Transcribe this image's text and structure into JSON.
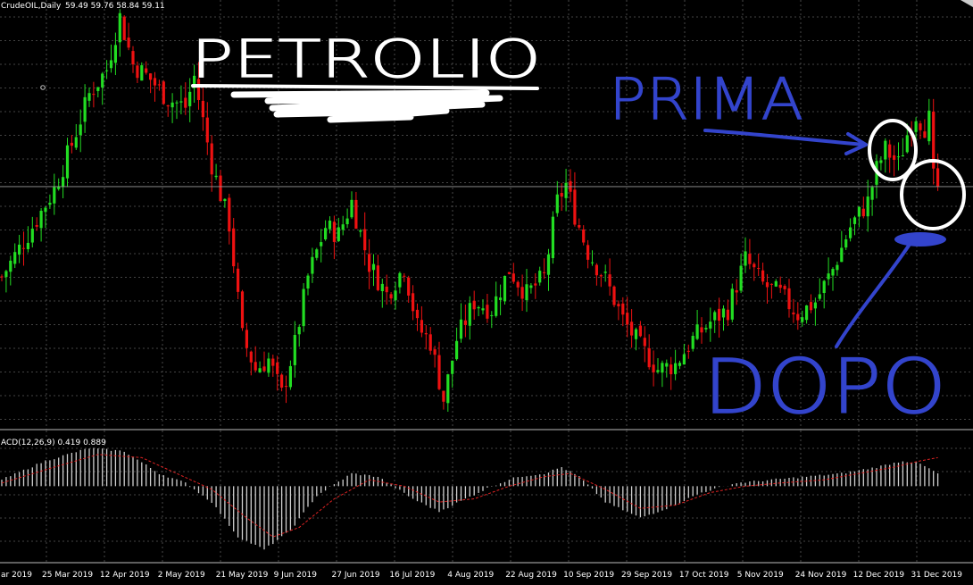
{
  "window": {
    "symbol_label": "CrudeOIL,Daily",
    "ohlc_label": "59.49 59.76 58.84 59.11",
    "macd_label": "ACD(12,26,9) 0.419 0.889"
  },
  "annotations": {
    "title": "PETROLIO",
    "before": "PRIMA",
    "after": "DOPO"
  },
  "colors": {
    "background": "#000000",
    "grid": "#5a5a5a",
    "bull": "#22dd22",
    "bear": "#ee1111",
    "macd_hist": "#d0d0d0",
    "macd_signal": "#dd2222",
    "ink_white": "#ffffff",
    "ink_blue": "#3344cc"
  },
  "chart_data": [
    {
      "type": "candlestick",
      "symbol": "CrudeOIL",
      "timeframe": "Daily",
      "x_tick_labels": [
        "ar 2019",
        "25 Mar 2019",
        "12 Apr 2019",
        "2 May 2019",
        "21 May 2019",
        "9 Jun 2019",
        "27 Jun 2019",
        "16 Jul 2019",
        "4 Aug 2019",
        "22 Aug 2019",
        "10 Sep 2019",
        "29 Sep 2019",
        "17 Oct 2019",
        "5 Nov 2019",
        "24 Nov 2019",
        "12 Dec 2019",
        "31 Dec 2019"
      ],
      "ylim": [
        49.5,
        66.5
      ],
      "close_path": [
        [
          0,
          55.5
        ],
        [
          6,
          57.2
        ],
        [
          12,
          59.0
        ],
        [
          16,
          60.8
        ],
        [
          20,
          62.8
        ],
        [
          24,
          63.8
        ],
        [
          27,
          65.9
        ],
        [
          30,
          64.0
        ],
        [
          34,
          63.4
        ],
        [
          38,
          62.6
        ],
        [
          42,
          62.3
        ],
        [
          44,
          63.5
        ],
        [
          48,
          60.0
        ],
        [
          52,
          57.6
        ],
        [
          55,
          53.1
        ],
        [
          58,
          51.8
        ],
        [
          61,
          52.2
        ],
        [
          64,
          50.8
        ],
        [
          67,
          52.8
        ],
        [
          70,
          55.5
        ],
        [
          74,
          57.5
        ],
        [
          77,
          57.2
        ],
        [
          80,
          58.5
        ],
        [
          84,
          56.0
        ],
        [
          88,
          54.8
        ],
        [
          92,
          55.9
        ],
        [
          95,
          53.5
        ],
        [
          98,
          52.9
        ],
        [
          101,
          50.6
        ],
        [
          104,
          53.0
        ],
        [
          108,
          54.5
        ],
        [
          112,
          54.2
        ],
        [
          116,
          55.8
        ],
        [
          120,
          54.8
        ],
        [
          124,
          55.5
        ],
        [
          127,
          58.5
        ],
        [
          129,
          59.2
        ],
        [
          131,
          58.0
        ],
        [
          134,
          56.5
        ],
        [
          138,
          55.4
        ],
        [
          142,
          53.8
        ],
        [
          146,
          52.7
        ],
        [
          150,
          51.8
        ],
        [
          154,
          52.0
        ],
        [
          158,
          53.0
        ],
        [
          162,
          53.7
        ],
        [
          166,
          54.2
        ],
        [
          170,
          56.2
        ],
        [
          174,
          55.2
        ],
        [
          178,
          54.8
        ],
        [
          182,
          54.0
        ],
        [
          186,
          54.5
        ],
        [
          190,
          55.8
        ],
        [
          194,
          57.5
        ],
        [
          198,
          58.5
        ],
        [
          200,
          59.8
        ],
        [
          202,
          60.6
        ],
        [
          205,
          60.0
        ],
        [
          207,
          61.2
        ],
        [
          209,
          62.0
        ],
        [
          211,
          61.5
        ],
        [
          212,
          61.8
        ],
        [
          213,
          59.4
        ],
        [
          214,
          59.2
        ]
      ],
      "last_close": 59.11
    },
    {
      "type": "bar",
      "name": "MACD(12,26,9)",
      "macd_last": 0.419,
      "signal_last": 0.889,
      "ylim": [
        -2.3,
        1.7
      ],
      "macd_path": [
        [
          0,
          0.2
        ],
        [
          10,
          0.8
        ],
        [
          20,
          1.2
        ],
        [
          28,
          1.1
        ],
        [
          36,
          0.4
        ],
        [
          42,
          0.1
        ],
        [
          48,
          -0.5
        ],
        [
          54,
          -1.6
        ],
        [
          60,
          -2.0
        ],
        [
          66,
          -1.4
        ],
        [
          72,
          -0.3
        ],
        [
          80,
          0.4
        ],
        [
          86,
          0.3
        ],
        [
          94,
          -0.4
        ],
        [
          100,
          -0.8
        ],
        [
          106,
          -0.4
        ],
        [
          112,
          0.0
        ],
        [
          118,
          0.3
        ],
        [
          124,
          0.4
        ],
        [
          128,
          0.6
        ],
        [
          132,
          0.3
        ],
        [
          138,
          -0.5
        ],
        [
          146,
          -1.0
        ],
        [
          152,
          -0.7
        ],
        [
          160,
          -0.2
        ],
        [
          168,
          0.1
        ],
        [
          176,
          0.2
        ],
        [
          184,
          0.3
        ],
        [
          192,
          0.4
        ],
        [
          200,
          0.6
        ],
        [
          206,
          0.8
        ],
        [
          210,
          0.7
        ],
        [
          214,
          0.4
        ]
      ],
      "signal_path": [
        [
          0,
          0.1
        ],
        [
          12,
          0.6
        ],
        [
          22,
          1.0
        ],
        [
          32,
          0.9
        ],
        [
          40,
          0.4
        ],
        [
          48,
          -0.1
        ],
        [
          56,
          -1.0
        ],
        [
          62,
          -1.6
        ],
        [
          68,
          -1.3
        ],
        [
          76,
          -0.4
        ],
        [
          84,
          0.2
        ],
        [
          92,
          0.0
        ],
        [
          100,
          -0.5
        ],
        [
          108,
          -0.4
        ],
        [
          116,
          0.0
        ],
        [
          124,
          0.3
        ],
        [
          130,
          0.4
        ],
        [
          138,
          -0.1
        ],
        [
          146,
          -0.7
        ],
        [
          154,
          -0.6
        ],
        [
          162,
          -0.2
        ],
        [
          170,
          0.0
        ],
        [
          178,
          0.1
        ],
        [
          188,
          0.2
        ],
        [
          196,
          0.4
        ],
        [
          204,
          0.6
        ],
        [
          210,
          0.8
        ],
        [
          214,
          0.9
        ]
      ]
    }
  ]
}
